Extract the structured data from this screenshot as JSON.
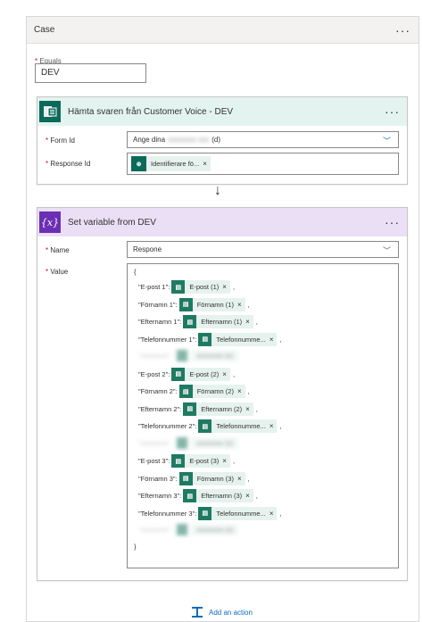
{
  "case": {
    "title": "Case",
    "equals_label": "Equals",
    "equals_value": "DEV"
  },
  "customer_voice": {
    "title": "Hämta svaren från Customer Voice - DEV",
    "form_id_label": "Form Id",
    "form_id_value": "Ange dina",
    "form_id_suffix": "(d)",
    "response_id_label": "Response Id",
    "response_id_token": "Identifierare fö..."
  },
  "set_variable": {
    "title": "Set variable from DEV",
    "icon_text": "{x}",
    "name_label": "Name",
    "name_value": "Respone",
    "value_label": "Value",
    "open_brace": "{",
    "close_brace": "}",
    "rows": [
      {
        "key": "\"E-post 1\":",
        "token": "E-post (1)"
      },
      {
        "key": "\"Förnamn 1\":",
        "token": "Förnamn (1)"
      },
      {
        "key": "\"Efternamn 1\":",
        "token": "Efternamn (1)"
      },
      {
        "key": "\"Telefonnummer 1\":",
        "token": "Telefonnumme..."
      },
      {
        "key": "\"E-post 2\":",
        "token": "E-post (2)"
      },
      {
        "key": "\"Förnamn 2\":",
        "token": "Förnamn (2)"
      },
      {
        "key": "\"Efternamn 2\":",
        "token": "Efternamn (2)"
      },
      {
        "key": "\"Telefonnummer 2\":",
        "token": "Telefonnumme..."
      },
      {
        "key": "\"E-post 3\":",
        "token": "E-post (3)"
      },
      {
        "key": "\"Förnamn 3\":",
        "token": "Förnamn (3)"
      },
      {
        "key": "\"Efternamn 3\":",
        "token": "Efternamn (3)"
      },
      {
        "key": "\"Telefonnummer 3\":",
        "token": "Telefonnumme..."
      }
    ],
    "separator": ","
  },
  "footer": {
    "add_action_label": "Add an action"
  },
  "colors": {
    "cv_header": "#e3f4f0",
    "cv_icon": "#0b6a5a",
    "sv_header": "#eadff5",
    "sv_icon": "#6b2fb3",
    "token": "#1f7a63"
  },
  "icons": {
    "more": "ellipsis-icon",
    "form": "forms-icon",
    "token": "forms-token-icon",
    "arrow": "arrow-down-icon",
    "add": "add-action-icon"
  }
}
